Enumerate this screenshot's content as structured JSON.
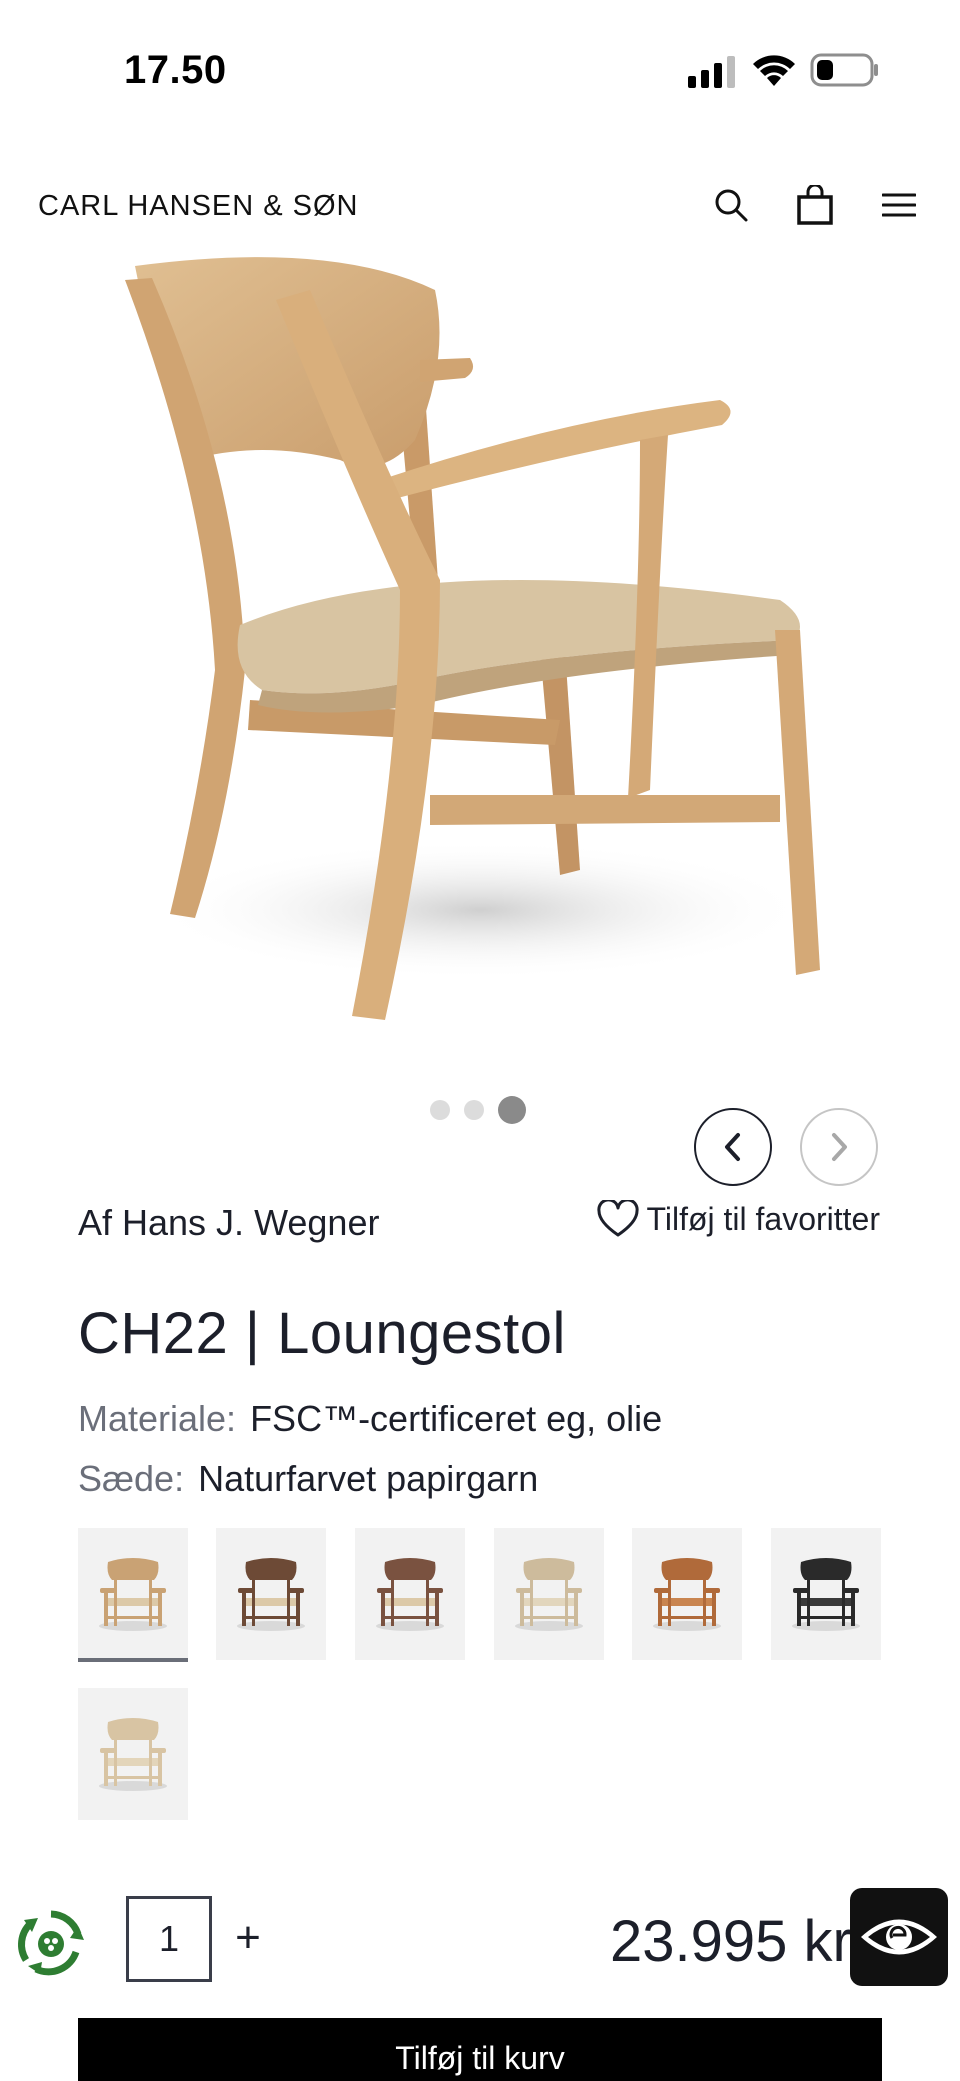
{
  "status_bar": {
    "time": "17.50"
  },
  "header": {
    "brand": "CARL HANSEN & SØN"
  },
  "carousel": {
    "slide_count": 3,
    "active_slide": 3
  },
  "product": {
    "designer": "Af Hans J. Wegner",
    "favorite_label": "Tilføj til favoritter",
    "title": "CH22 | Loungestol",
    "specs": [
      {
        "label": "Materiale:",
        "value": "FSC™-certificeret eg, olie"
      },
      {
        "label": "Sæde:",
        "value": "Naturfarvet papirgarn"
      }
    ],
    "variants": [
      {
        "name": "oak-natural",
        "frame": "#c9a274",
        "seat": "#dcc9a8",
        "selected": true
      },
      {
        "name": "walnut-natural",
        "frame": "#6d4a36",
        "seat": "#dcc9a8",
        "selected": false
      },
      {
        "name": "walnut-oiled",
        "frame": "#7a5240",
        "seat": "#dcc9a8",
        "selected": false
      },
      {
        "name": "oak-white",
        "frame": "#cdbb9c",
        "seat": "#e2d6bd",
        "selected": false
      },
      {
        "name": "teak-cognac",
        "frame": "#b06a3a",
        "seat": "#c98550",
        "selected": false
      },
      {
        "name": "black-painted",
        "frame": "#2a2a2a",
        "seat": "#3a3a3a",
        "selected": false
      },
      {
        "name": "oak-soap",
        "frame": "#d8c4a3",
        "seat": "#e3d5ba",
        "selected": false
      }
    ]
  },
  "purchase": {
    "quantity": "1",
    "plus_label": "+",
    "price": "23.995 kr",
    "add_to_cart": "Tilføj til kurv"
  }
}
